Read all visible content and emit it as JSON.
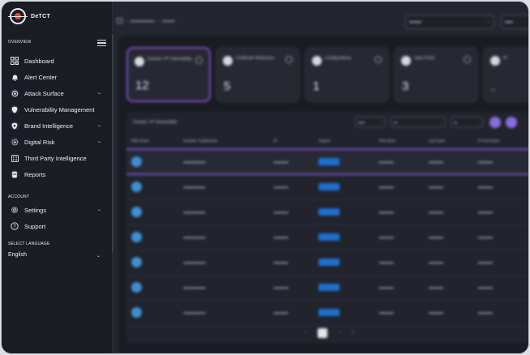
{
  "app": {
    "name": "DeTCT"
  },
  "sidebar": {
    "overview_label": "OVERVIEW",
    "items": [
      {
        "label": "Dashboard",
        "icon": "dashboard-icon"
      },
      {
        "label": "Alert Center",
        "icon": "bell-icon"
      },
      {
        "label": "Attack Surface",
        "icon": "target-icon",
        "expandable": true
      },
      {
        "label": "Vulnerability Management",
        "icon": "shield-icon"
      },
      {
        "label": "Brand Intelligence",
        "icon": "brand-icon",
        "expandable": true
      },
      {
        "label": "Digital Risk",
        "icon": "risk-icon",
        "expandable": true
      },
      {
        "label": "Third Party Intelligence",
        "icon": "third-party-icon"
      },
      {
        "label": "Reports",
        "icon": "report-icon"
      }
    ],
    "account_label": "ACCOUNT",
    "account_items": [
      {
        "label": "Settings",
        "icon": "gear-icon",
        "expandable": true
      },
      {
        "label": "Support",
        "icon": "help-icon"
      }
    ],
    "language_label": "SELECT LANGUAGE",
    "language_value": "English"
  },
  "main": {
    "cards": [
      {
        "title": "Domain / IP Vulnerability",
        "value": "12",
        "active": true
      },
      {
        "title": "Certificate Weakness",
        "value": "5"
      },
      {
        "title": "Configurations",
        "value": "1"
      },
      {
        "title": "Open Ports",
        "value": "3"
      },
      {
        "title": "IP",
        "value": "--"
      }
    ],
    "table": {
      "title": "Domain / IP Vulnerability",
      "columns": [
        "Risk Score",
        "Domain / Subdomain",
        "IP",
        "Impact",
        "First Seen",
        "Last Seen",
        "IP First Seen"
      ],
      "rows": 7,
      "highlighted_row": 0
    }
  },
  "colors": {
    "accent": "#7c4dcc",
    "sidebar_bg": "#1a1d24",
    "main_bg": "#23262e",
    "risk_dot": "#3f8fd6",
    "impact_pill": "#1d6fd0"
  }
}
